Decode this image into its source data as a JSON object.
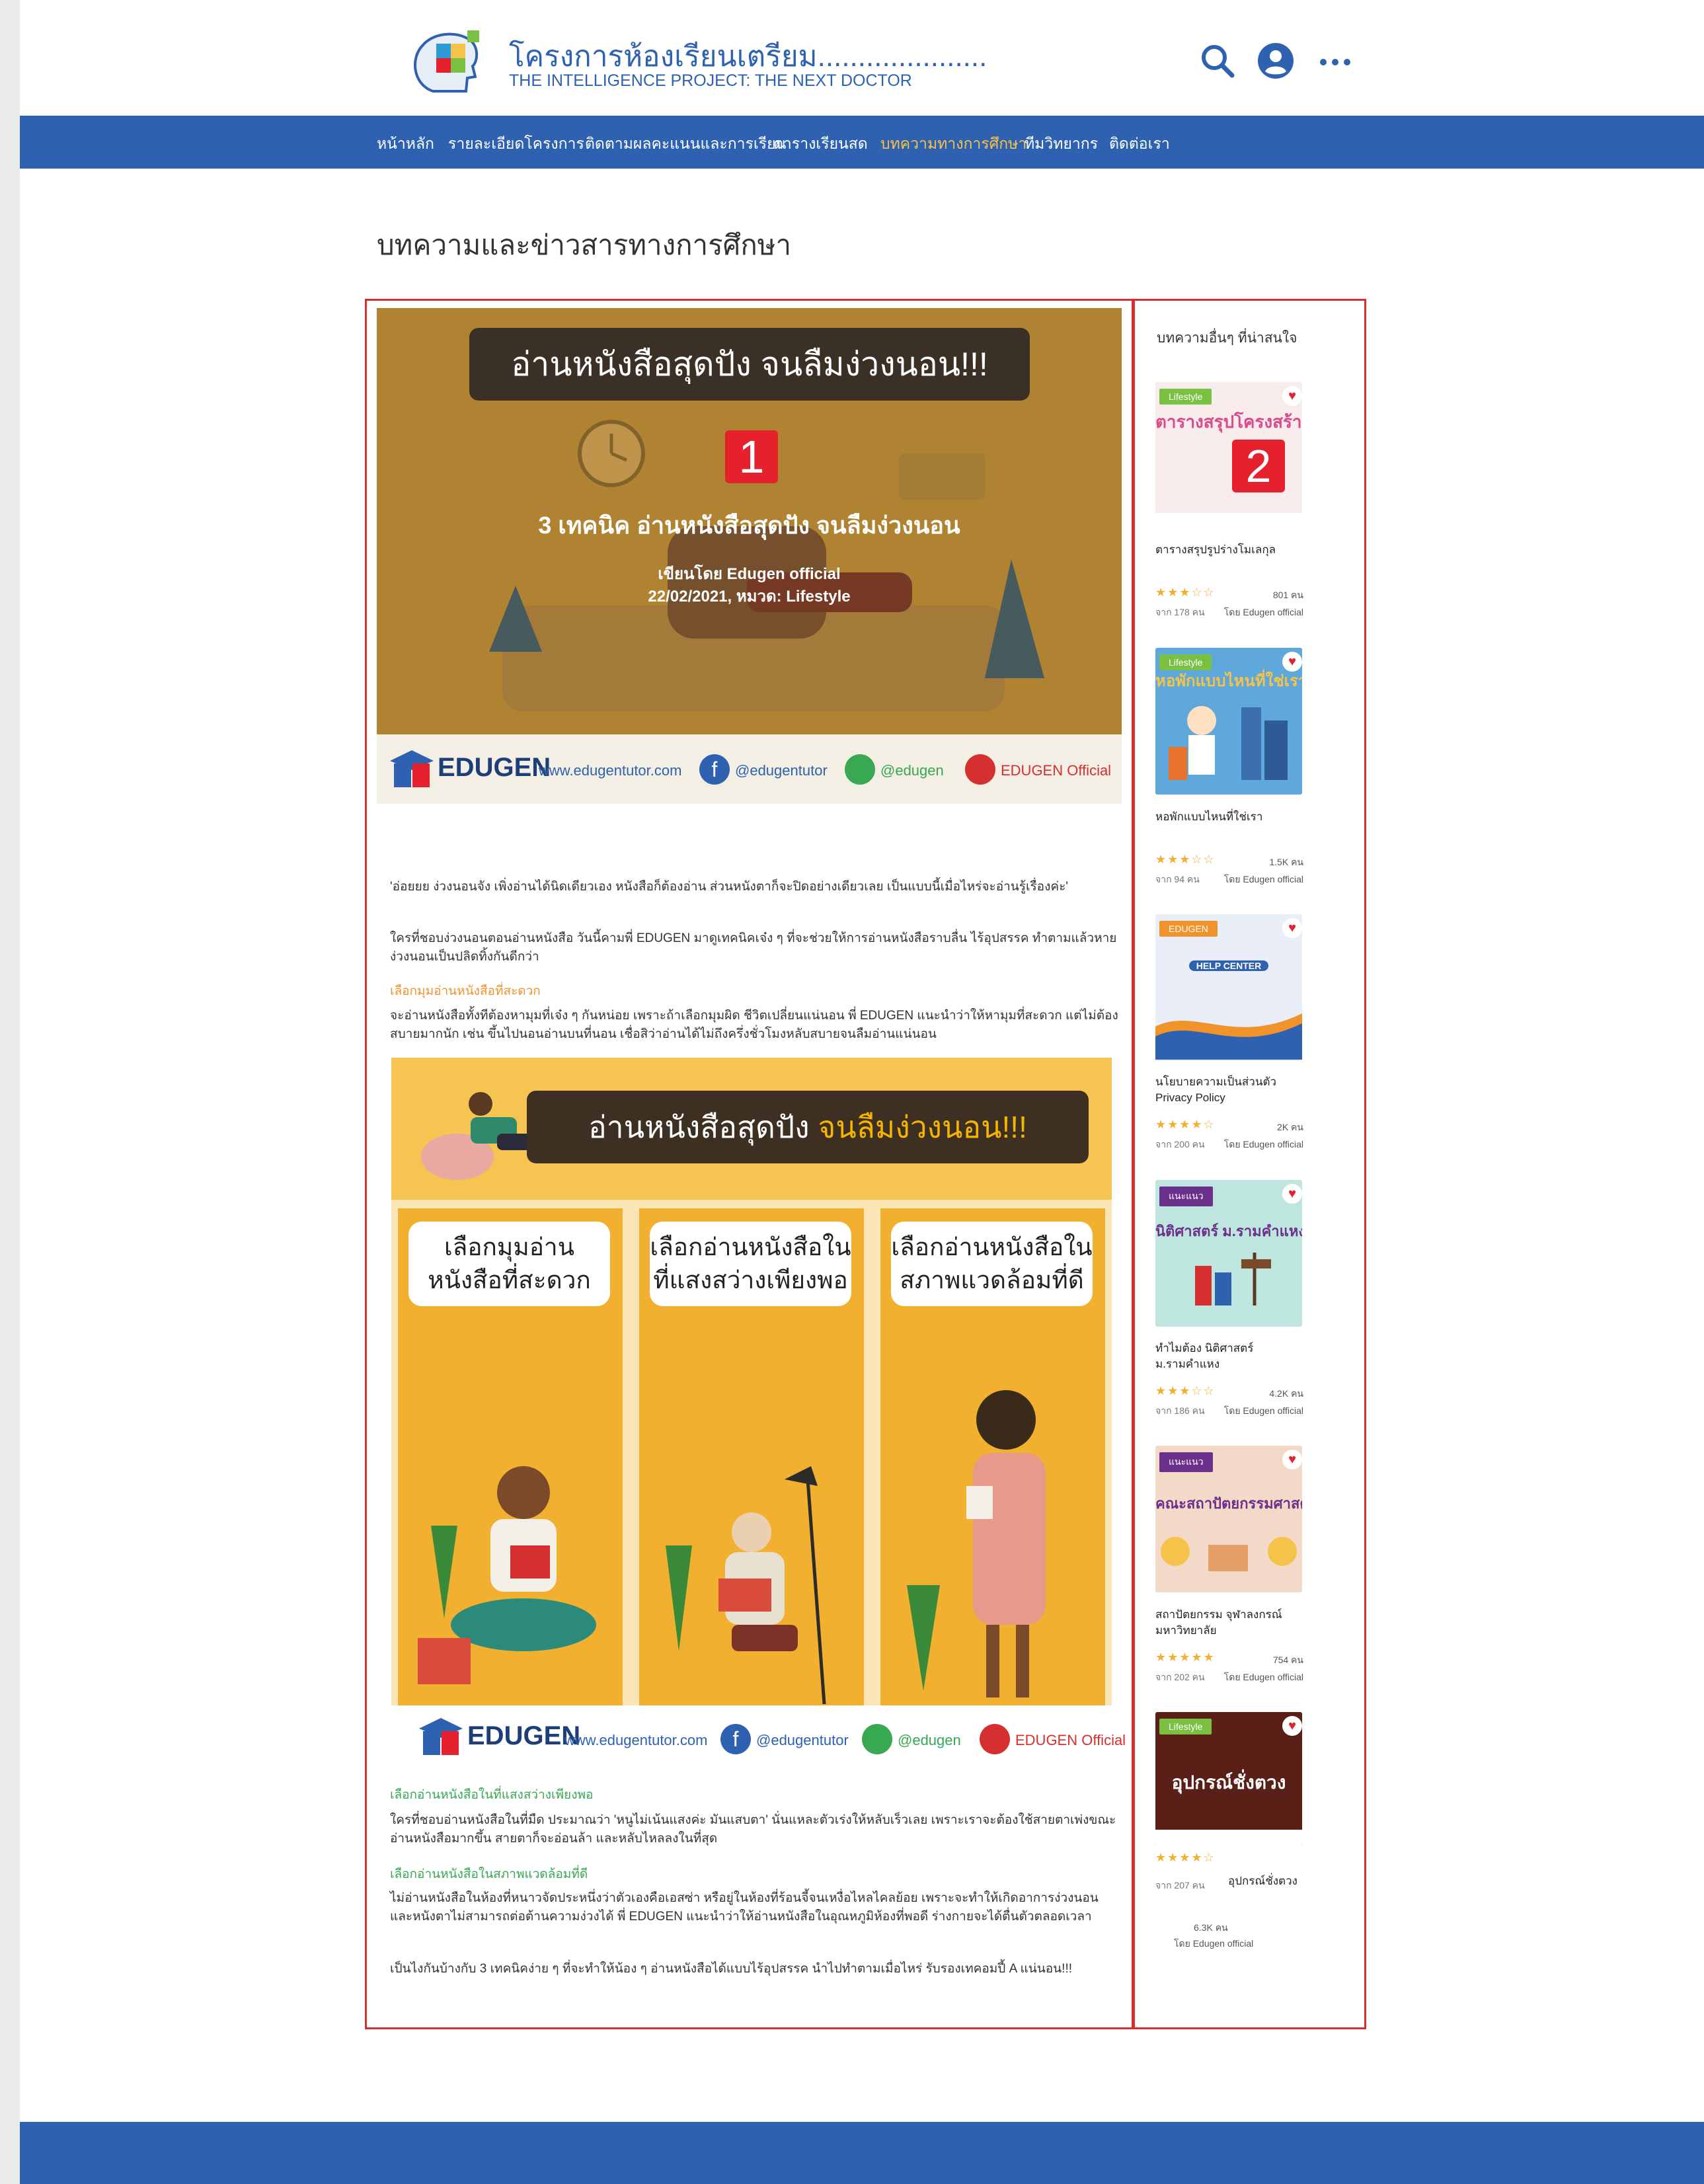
{
  "header": {
    "site_title": "โครงการห้องเรียนเตรียม.....................",
    "site_subtitle": "THE INTELLIGENCE PROJECT: THE NEXT DOCTOR",
    "icons": [
      "search-icon",
      "user-account-icon",
      "more-options-icon"
    ]
  },
  "nav": {
    "items": [
      {
        "label": "หน้าหลัก",
        "active": false
      },
      {
        "label": "รายละเอียดโครงการ",
        "active": false
      },
      {
        "label": "ติดตามผลคะแนนและการเรียน",
        "active": false
      },
      {
        "label": "ตารางเรียนสด",
        "active": false
      },
      {
        "label": "บทความทางการศึกษา",
        "active": true
      },
      {
        "label": "ทีมวิทยากร",
        "active": false
      },
      {
        "label": "ติดต่อเรา",
        "active": false
      }
    ]
  },
  "page_heading": "บทความและข่าวสารทางการศึกษา",
  "markers": {
    "main": "1",
    "sidebar": "2"
  },
  "article": {
    "hero_banner": "อ่านหนังสือสุดปัง จนลืมง่วงนอน!!!",
    "hero_title": "3 เทคนิค อ่านหนังสือสุดปัง จนลืมง่วงนอน",
    "hero_author": "เขียนโดย Edugen official",
    "hero_date_category": "22/02/2021, หมวด: Lifestyle",
    "brand": "EDUGEN",
    "website": "www.edugentutor.com",
    "facebook": "@edugentutor",
    "line": "@edugen",
    "youtube": "EDUGEN Official",
    "intro": "'อ่อยยย ง่วงนอนจัง เพิ่งอ่านได้นิดเดียวเอง หนังสือก็ต้องอ่าน ส่วนหนังตาก็จะปิดอย่างเดียวเลย เป็นแบบนี้เมื่อไหร่จะอ่านรู้เรื่องค่ะ'",
    "para1": "ใครที่ชอบง่วงนอนตอนอ่านหนังสือ วันนี้คามพี่ EDUGEN มาดูเทคนิคเจ๋ง ๆ ที่จะช่วยให้การอ่านหนังสือราบลื่น ไร้อุปสรรค ทำตามแล้วหายง่วงนอนเป็นปลิดทิ้งกันดีกว่า",
    "subhead1": "เลือกมุมอ่านหนังสือที่สะดวก",
    "para2": "จะอ่านหนังสือทั้งทีต้องหามุมที่เจ๋ง ๆ กันหน่อย เพราะถ้าเลือกมุมผิด ชีวิตเปลี่ยนแน่นอน พี่ EDUGEN แนะนำว่าให้หามุมที่สะดวก แต่ไม่ต้องสบายมากนัก เช่น ขึ้นไปนอนอ่านบนที่นอน เชื่อสิว่าอ่านได้ไม่ถึงครึ่งชั่วโมงหลับสบายจนลืมอ่านแน่นอน",
    "info_banner_a": "อ่านหนังสือสุดปัง ",
    "info_banner_b": "จนลืมง่วงนอน!!!",
    "bubbles": [
      "เลือกมุมอ่านหนังสือที่สะดวก",
      "เลือกอ่านหนังสือในที่แสงสว่างเพียงพอ",
      "เลือกอ่านหนังสือในสภาพแวดล้อมที่ดี"
    ],
    "info_website": "www.edugentutor.com",
    "subhead2": "เลือกอ่านหนังสือในที่แสงสว่างเพียงพอ",
    "para3": "ใครที่ชอบอ่านหนังสือในที่มืด ประมาณว่า 'หนูไม่เน้นแสงค่ะ มันแสบตา' นั่นแหละตัวเร่งให้หลับเร็วเลย เพราะเราจะต้องใช้สายตาเพ่งขณะอ่านหนังสือมากขึ้น สายตาก็จะอ่อนล้า และหลับไหลลงในที่สุด",
    "subhead3": "เลือกอ่านหนังสือในสภาพแวดล้อมที่ดี",
    "para4": "ไม่อ่านหนังสือในห้องที่หนาวจัดประหนึ่งว่าตัวเองคือเอสซ่า หรือยู่ในห้องที่ร้อนจี้จนเหงื่อไหลไคลย้อย เพราะจะทำให้เกิดอาการง่วงนอน และหนังตาไม่สามารถต่อต้านความง่วงได้ พี่ EDUGEN แนะนำว่าให้อ่านหนังสือในอุณหภูมิห้องที่พอดี ร่างกายจะได้ตื่นตัวตลอดเวลา",
    "para5": "เป็นไงกันบ้างกับ 3 เทคนิคง่าย ๆ ที่จะทำให้น้อง ๆ อ่านหนังสือได้แบบไร้อุปสรรค นำไปทำตามเมื่อไหร่ รับรองเทคอมปี้ A แน่นอน!!!"
  },
  "sidebar": {
    "title": "บทความอื่นๆ ที่น่าสนใจ",
    "cards": [
      {
        "tag": "Lifestyle",
        "tag_color": "#7ac143",
        "img_text": "ตารางสรุปโครงสร้างโมเลกุล",
        "title": "ตารางสรุปรูปร่างโมเลกุล",
        "stars": "★★★☆☆",
        "views": "801 คน",
        "from": "จาก 178 คน",
        "by": "โดย Edugen official"
      },
      {
        "tag": "Lifestyle",
        "tag_color": "#7ac143",
        "img_text": "หอพักแบบไหนที่ใช่เรา",
        "title": "หอพักแบบไหนที่ใช่เรา",
        "stars": "★★★☆☆",
        "views": "1.5K คน",
        "from": "จาก 94 คน",
        "by": "โดย Edugen official"
      },
      {
        "tag": "EDUGEN",
        "tag_color": "#f0932b",
        "img_text": "HELP CENTER",
        "title": "นโยบายความเป็นส่วนตัว Privacy Policy",
        "stars": "★★★★☆",
        "views": "2K คน",
        "from": "จาก 200 คน",
        "by": "โดย Edugen official"
      },
      {
        "tag": "แนะแนว",
        "tag_color": "#6b2f8c",
        "img_text": "นิติศาสตร์ ม.รามคำแหง",
        "title": "ทำไมต้อง นิติศาสตร์ ม.รามคำแหง",
        "stars": "★★★☆☆",
        "views": "4.2K คน",
        "from": "จาก 186 คน",
        "by": "โดย Edugen official"
      },
      {
        "tag": "แนะแนว",
        "tag_color": "#6b2f8c",
        "img_text": "คณะสถาปัตยกรรมศาสตร์",
        "title": "สถาปัตยกรรม จุฬาลงกรณ์มหาวิทยาลัย",
        "stars": "★★★★★",
        "views": "754 คน",
        "from": "จาก 202 คน",
        "by": "โดย Edugen official"
      },
      {
        "tag": "Lifestyle",
        "tag_color": "#7ac143",
        "img_text": "อุปกรณ์ชั่งตวง",
        "title": "อุปกรณ์ชั่งตวง",
        "stars": "★★★★☆",
        "views": "6.3K คน",
        "from": "จาก 207 คน",
        "by": "โดย Edugen official"
      }
    ]
  },
  "colors": {
    "brand_blue": "#2e62b0",
    "accent_orange": "#f5c24a",
    "marker_red": "#e5212e"
  }
}
